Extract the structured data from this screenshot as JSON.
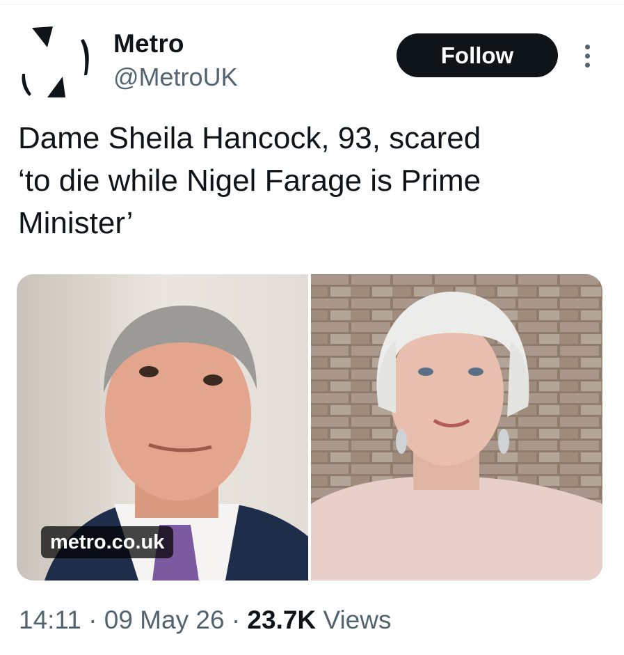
{
  "account": {
    "display_name": "Metro",
    "handle": "@MetroUK",
    "avatar_icon": "metro-logo-icon"
  },
  "actions": {
    "follow_label": "Follow",
    "more_icon": "more-vertical-icon"
  },
  "tweet": {
    "text": "Dame Sheila Hancock, 93, scared\n‘to die while Nigel Farage is Prime\nMinister’"
  },
  "media": {
    "source_label": "metro.co.uk"
  },
  "meta": {
    "time": "14:11",
    "separator": "·",
    "date": "09 May 26",
    "views_count": "23.7K",
    "views_label": "Views"
  },
  "colors": {
    "text_primary": "#0f1419",
    "text_secondary": "#536471",
    "button_bg": "#0f1419",
    "button_text": "#ffffff"
  }
}
